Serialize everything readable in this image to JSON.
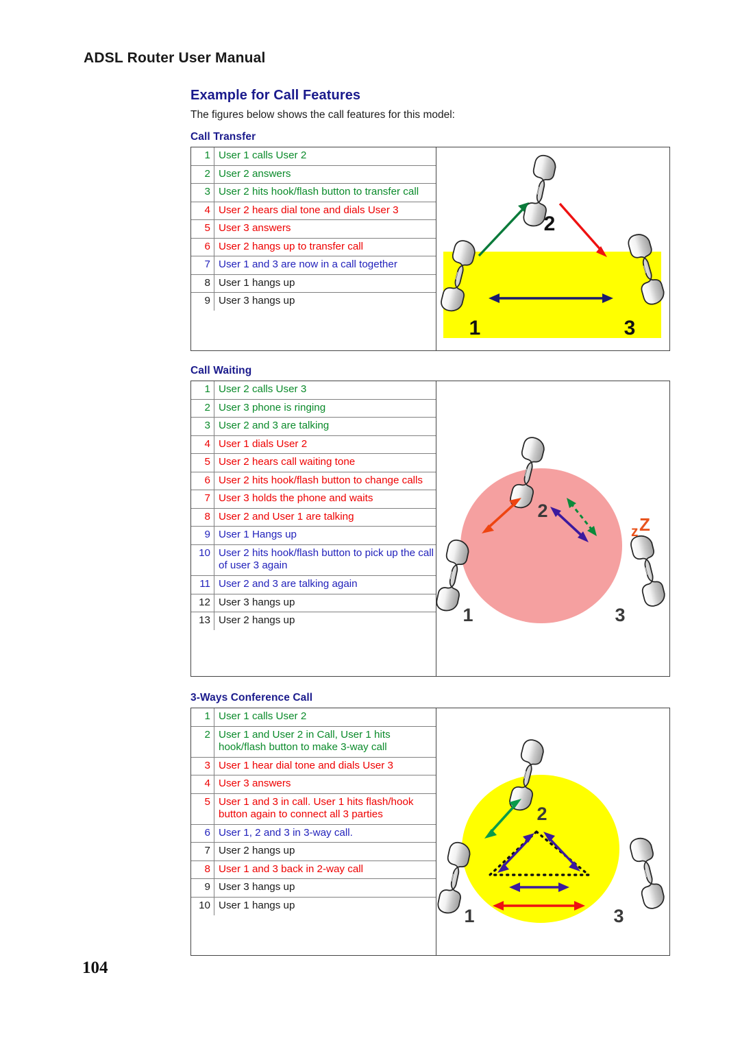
{
  "header": {
    "running_title": "ADSL Router User Manual"
  },
  "section": {
    "title": "Example for Call Features",
    "intro": "The figures below shows the call features for this model:"
  },
  "features": [
    {
      "title": "Call Transfer",
      "steps": [
        {
          "n": "1",
          "text": "User 1 calls User 2",
          "color": "green"
        },
        {
          "n": "2",
          "text": "User 2 answers",
          "color": "green"
        },
        {
          "n": "3",
          "text": "User 2 hits hook/flash button to transfer call",
          "color": "green"
        },
        {
          "n": "4",
          "text": "User 2 hears dial tone and dials User 3",
          "color": "red"
        },
        {
          "n": "5",
          "text": "User 3 answers",
          "color": "red"
        },
        {
          "n": "6",
          "text": "User 2 hangs up to transfer call",
          "color": "red"
        },
        {
          "n": "7",
          "text": "User 1 and 3 are now in a call together",
          "color": "blue"
        },
        {
          "n": "8",
          "text": "User 1 hangs up",
          "color": "black"
        },
        {
          "n": "9",
          "text": "User 3 hangs up",
          "color": "black"
        }
      ],
      "figure": {
        "name": "call-transfer-diagram",
        "backdrop": "yellow-band",
        "backdrop_color": "#ffff00",
        "phone_labels": [
          "1",
          "2",
          "3"
        ],
        "arrows": [
          {
            "from": "1",
            "to": "2",
            "color": "#0a7a3a",
            "style": "solid",
            "heads": "one"
          },
          {
            "from": "2",
            "to": "3",
            "color": "#ee1111",
            "style": "solid",
            "heads": "one"
          },
          {
            "from": "1",
            "to": "3",
            "color": "#1a1a6e",
            "style": "solid",
            "heads": "both"
          }
        ]
      }
    },
    {
      "title": "Call Waiting",
      "steps": [
        {
          "n": "1",
          "text": "User 2 calls User 3",
          "color": "green"
        },
        {
          "n": "2",
          "text": "User 3 phone is ringing",
          "color": "green"
        },
        {
          "n": "3",
          "text": "User 2 and 3 are talking",
          "color": "green"
        },
        {
          "n": "4",
          "text": "User 1 dials User 2",
          "color": "red"
        },
        {
          "n": "5",
          "text": "User 2 hears call waiting tone",
          "color": "red"
        },
        {
          "n": "6",
          "text": "User 2 hits hook/flash button to change calls",
          "color": "red"
        },
        {
          "n": "7",
          "text": "User 3 holds the phone and waits",
          "color": "red"
        },
        {
          "n": "8",
          "text": "User 2 and User 1 are talking",
          "color": "red"
        },
        {
          "n": "9",
          "text": "User 1 Hangs up",
          "color": "blue"
        },
        {
          "n": "10",
          "text": "User 2 hits hook/flash button to pick up the call of user 3 again",
          "color": "blue"
        },
        {
          "n": "11",
          "text": "User 2 and 3 are talking again",
          "color": "blue"
        },
        {
          "n": "12",
          "text": "User 3 hangs up",
          "color": "black"
        },
        {
          "n": "13",
          "text": "User 2 hangs up",
          "color": "black"
        }
      ],
      "figure": {
        "name": "call-waiting-diagram",
        "backdrop": "pink-circle",
        "backdrop_color": "#f5a0a0",
        "phone_labels": [
          "1",
          "2",
          "3"
        ],
        "sleep_label": "zZ",
        "sleep_color": "#e8541e",
        "arrows": [
          {
            "from": "1",
            "to": "2",
            "color": "#ee4411",
            "style": "solid",
            "heads": "both"
          },
          {
            "from": "2",
            "to": "3",
            "color": "#3b1a9e",
            "style": "solid",
            "heads": "both"
          },
          {
            "from": "2",
            "to": "3",
            "color": "#0a8a3a",
            "style": "dashed",
            "heads": "both"
          }
        ]
      }
    },
    {
      "title": "3-Ways Conference Call",
      "steps": [
        {
          "n": "1",
          "text": "User 1 calls User 2",
          "color": "green"
        },
        {
          "n": "2",
          "text": "User 1 and User 2 in Call, User 1 hits hook/flash button to make 3-way call",
          "color": "green"
        },
        {
          "n": "3",
          "text": "User 1 hear dial tone and dials User 3",
          "color": "red"
        },
        {
          "n": "4",
          "text": "User 3 answers",
          "color": "red"
        },
        {
          "n": "5",
          "text": "User 1 and 3 in call. User 1 hits flash/hook button again to connect all 3 parties",
          "color": "red"
        },
        {
          "n": "6",
          "text": "User 1, 2 and 3 in 3-way call.",
          "color": "blue"
        },
        {
          "n": "7",
          "text": "User 2 hangs up",
          "color": "black"
        },
        {
          "n": "8",
          "text": "User 1 and 3 back in 2-way call",
          "color": "red"
        },
        {
          "n": "9",
          "text": "User 3 hangs up",
          "color": "black"
        },
        {
          "n": "10",
          "text": "User 1 hangs up",
          "color": "black"
        }
      ],
      "figure": {
        "name": "three-way-conference-diagram",
        "backdrop": "yellow-circle",
        "backdrop_color": "#ffff00",
        "phone_labels": [
          "1",
          "2",
          "3"
        ],
        "arrows": [
          {
            "from": "1",
            "to": "2",
            "color": "#0a9a4a",
            "style": "solid",
            "heads": "both"
          },
          {
            "from": "1",
            "to": "2",
            "color": "#3b1a9e",
            "style": "solid",
            "heads": "both"
          },
          {
            "from": "2",
            "to": "3",
            "color": "#3b1a9e",
            "style": "solid",
            "heads": "both"
          },
          {
            "from": "1",
            "to": "3",
            "color": "#3b1a9e",
            "style": "solid",
            "heads": "both"
          },
          {
            "from": "1",
            "to": "3",
            "color": "#ee1111",
            "style": "solid",
            "heads": "both"
          }
        ],
        "conference_triangle": "dotted"
      }
    }
  ],
  "footer": {
    "page_number": "104"
  }
}
